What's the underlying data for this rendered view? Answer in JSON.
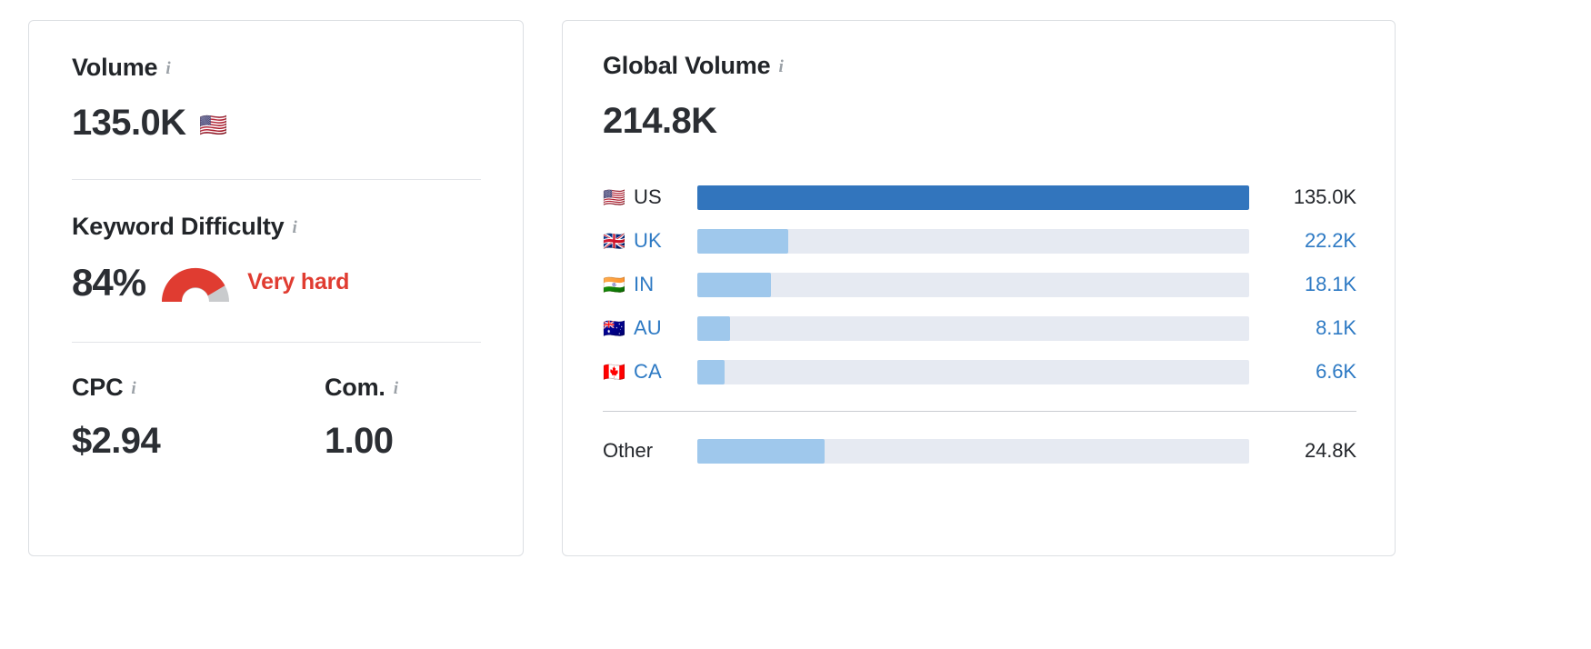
{
  "left_card": {
    "volume": {
      "label": "Volume",
      "info_icon": "info-icon",
      "value": "135.0K",
      "flag": "🇺🇸"
    },
    "keyword_difficulty": {
      "label": "Keyword Difficulty",
      "info_icon": "info-icon",
      "percent_text": "84%",
      "percent_value": 84,
      "verdict": "Very hard",
      "verdict_color": "#e03c31",
      "gauge_track_color": "#c9cbcd"
    },
    "cpc": {
      "label": "CPC",
      "info_icon": "info-icon",
      "value": "$2.94"
    },
    "competition": {
      "label": "Com.",
      "info_icon": "info-icon",
      "value": "1.00"
    }
  },
  "right_card": {
    "header": {
      "label": "Global Volume",
      "info_icon": "info-icon",
      "value": "214.8K"
    },
    "rows": [
      {
        "flag": "🇺🇸",
        "code": "US",
        "value": "135.0K",
        "pct": 100,
        "current": true
      },
      {
        "flag": "🇬🇧",
        "code": "UK",
        "value": "22.2K",
        "pct": 16.4,
        "current": false
      },
      {
        "flag": "🇮🇳",
        "code": "IN",
        "value": "18.1K",
        "pct": 13.4,
        "current": false
      },
      {
        "flag": "🇦🇺",
        "code": "AU",
        "value": "8.1K",
        "pct": 6.0,
        "current": false
      },
      {
        "flag": "🇨🇦",
        "code": "CA",
        "value": "6.6K",
        "pct": 4.9,
        "current": false
      }
    ],
    "other": {
      "label": "Other",
      "value": "24.8K",
      "pct": 23.0
    }
  },
  "chart_data": {
    "type": "bar",
    "title": "Global Volume",
    "total": "214.8K",
    "total_value": 214800,
    "orientation": "horizontal",
    "categories": [
      "US",
      "UK",
      "IN",
      "AU",
      "CA",
      "Other"
    ],
    "values": [
      135000,
      22200,
      18100,
      8100,
      6600,
      24800
    ],
    "value_labels": [
      "135.0K",
      "22.2K",
      "18.1K",
      "8.1K",
      "6.6K",
      "24.8K"
    ],
    "xlabel": "",
    "ylabel": "",
    "xlim": [
      0,
      135000
    ],
    "grid": false,
    "legend": "none",
    "colors": {
      "primary_bar": "#3275bd",
      "secondary_bar": "#9fc8ec",
      "track": "#e6eaf2"
    }
  }
}
